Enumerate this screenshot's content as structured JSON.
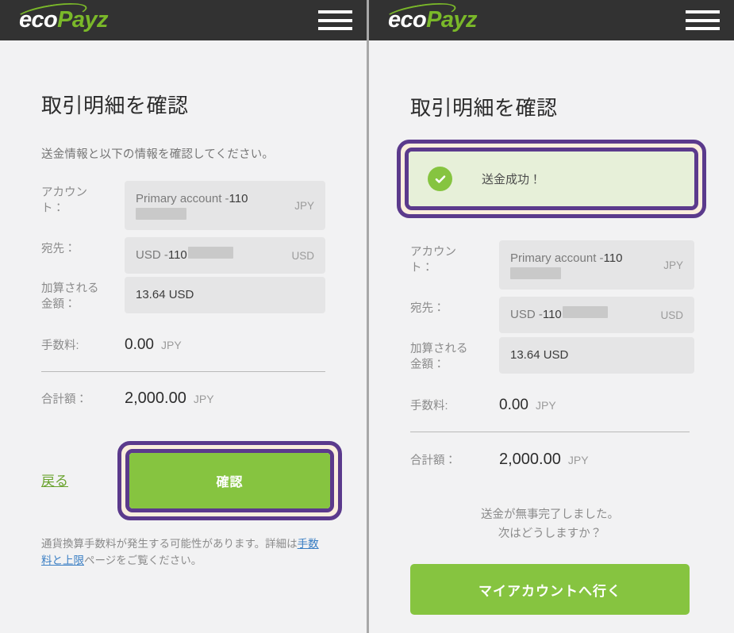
{
  "brand": {
    "logo_eco": "eco",
    "logo_payz": "Payz",
    "green": "#86c440",
    "dark": "#323232",
    "highlight_purple": "#5b3a8c",
    "highlight_cream": "#faeedd"
  },
  "left": {
    "title": "取引明細を確認",
    "intro": "送金情報と以下の情報を確認してください。",
    "fields": [
      {
        "label": "アカウント：",
        "value_prefix": "Primary account - ",
        "value_strong": "110",
        "redacted": true,
        "currency": "JPY"
      },
      {
        "label": "宛先：",
        "value_prefix": "USD - ",
        "value_strong": "110",
        "redacted": true,
        "currency": "USD"
      },
      {
        "label": "加算される\n金額：",
        "value_plain": "13.64 USD",
        "redacted": false,
        "currency": ""
      }
    ],
    "fee_label": "手数料:",
    "fee_value": "0.00",
    "fee_currency": "JPY",
    "total_label": "合計額：",
    "total_value": "2,000.00",
    "total_currency": "JPY",
    "back_link": "戻る",
    "confirm_button": "確認",
    "footnote_before": "通貨換算手数料が発生する可能性があります。詳細は",
    "footnote_link": "手数料と上限",
    "footnote_after": "ページをご覧ください。"
  },
  "right": {
    "title": "取引明細を確認",
    "success_message": "送金成功！",
    "success_icon": "check-circle-icon",
    "fields": [
      {
        "label": "アカウント：",
        "value_prefix": "Primary account - ",
        "value_strong": "110",
        "redacted": true,
        "currency": "JPY"
      },
      {
        "label": "宛先：",
        "value_prefix": "USD - ",
        "value_strong": "110",
        "redacted": true,
        "currency": "USD"
      },
      {
        "label": "加算される\n金額：",
        "value_plain": "13.64 USD",
        "redacted": false,
        "currency": ""
      }
    ],
    "fee_label": "手数料:",
    "fee_value": "0.00",
    "fee_currency": "JPY",
    "total_label": "合計額：",
    "total_value": "2,000.00",
    "total_currency": "JPY",
    "done_line1": "送金が無事完了しました。",
    "done_line2": "次はどうしますか？",
    "account_button": "マイアカウントへ行く"
  },
  "icons": {
    "hamburger": "hamburger-menu-icon"
  }
}
